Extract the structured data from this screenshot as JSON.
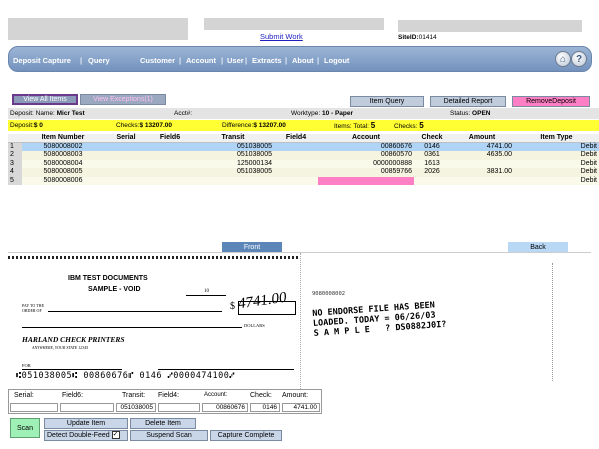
{
  "header": {
    "submit_link": "Submit Work",
    "site_label": "SiteID:",
    "site_value": "01414"
  },
  "nav": {
    "items": [
      "Deposit Capture",
      "Query",
      "Customer",
      "Account",
      "User",
      "Extracts",
      "About",
      "Logout"
    ],
    "separator": "|"
  },
  "buttons": {
    "view_all": "View All Items",
    "view_exceptions": "View Exceptions(1)",
    "item_query": "Item Query",
    "detailed_report": "Detailed Report",
    "remove_deposit": "RemoveDeposit"
  },
  "deposit": {
    "name_label": "Deposit: Name:",
    "name_value": "Micr Test",
    "acct_label": "Acct#:",
    "worktype_label": "Worktype:",
    "worktype_value": "10 - Paper",
    "status_label": "Status:",
    "status_value": "OPEN"
  },
  "totals": {
    "deposit_label": "Deposit:",
    "deposit_value": "$ 0",
    "checks_label": "Checks:",
    "checks_value": "$ 13207.00",
    "difference_label": "Difference:",
    "difference_value": "$ 13207.00",
    "items_label": "Items:",
    "total_label": "Total:",
    "total_value": "5",
    "checks_count_label": "Checks:",
    "checks_count_value": "5"
  },
  "table": {
    "headers": [
      "Item Number",
      "Serial",
      "Field6",
      "Transit",
      "Field4",
      "Account",
      "Check",
      "Amount",
      "Item Type"
    ],
    "rows": [
      {
        "n": "1",
        "item": "5080008002",
        "serial": "",
        "field6": "",
        "transit": "051038005",
        "field4": "",
        "account": "00860676",
        "check": "0146",
        "amount": "4741.00",
        "type": "Debit"
      },
      {
        "n": "2",
        "item": "5080008003",
        "serial": "",
        "field6": "",
        "transit": "051038005",
        "field4": "",
        "account": "00860570",
        "check": "0361",
        "amount": "4635.00",
        "type": "Debit"
      },
      {
        "n": "3",
        "item": "5080008004",
        "serial": "",
        "field6": "",
        "transit": "125000134",
        "field4": "",
        "account": "0000000888",
        "check": "1613",
        "amount": "",
        "type": "Debit"
      },
      {
        "n": "4",
        "item": "5080008005",
        "serial": "",
        "field6": "",
        "transit": "051038005",
        "field4": "",
        "account": "00859766",
        "check": "2026",
        "amount": "3831.00",
        "type": "Debit"
      },
      {
        "n": "5",
        "item": "5080008006",
        "serial": "",
        "field6": "",
        "transit": "",
        "field4": "",
        "account": "",
        "check": "",
        "amount": "",
        "type": "Debit"
      }
    ]
  },
  "image_tabs": {
    "front": "Front",
    "back": "Back"
  },
  "check_front": {
    "bank": "IBM TEST DOCUMENTS",
    "sample": "SAMPLE - VOID",
    "payto": "PAY TO THE ORDER OF",
    "dollar_sign": "$",
    "amount_hand": "4741.00",
    "dollars": "DOLLARS",
    "printer": "HARLAND CHECK PRINTERS",
    "printer_sub": "ANYWHERE, YOUR STATE 12345",
    "for": "FOR",
    "micr": "⑆051038005⑆ 00860676⑈  0146  ⑇0000474100⑇",
    "check_no": "10"
  },
  "check_back": {
    "code": "9080008002",
    "endorse": "NO ENDORSE FILE HAS BEEN\nLOADED. TODAY = 06/26/03\nS A M P L E   ? DS0882J0I?"
  },
  "fields": {
    "serial_label": "Serial:",
    "field6_label": "Field6:",
    "transit_label": "Transit:",
    "field4_label": "Field4:",
    "account_label": "Account:",
    "check_label": "Check:",
    "amount_label": "Amount:",
    "serial_value": "",
    "field6_value": "",
    "transit_value": "051038005",
    "field4_value": "",
    "account_value": "00860676",
    "check_value": "0146",
    "amount_value": "4741.00"
  },
  "actions": {
    "scan": "Scan",
    "update_item": "Update Item",
    "delete_item": "Delete Item",
    "detect_double": "Detect Double-Feed",
    "suspend_scan": "Suspend Scan",
    "capture_complete": "Capture Complete"
  },
  "colors": {
    "nav_bg": "#7f9cc6",
    "selected_row": "#b0d4f5",
    "totals_bg": "#ffff33",
    "remove_btn": "#ff7fc4",
    "scan_btn": "#9ff0b6"
  }
}
